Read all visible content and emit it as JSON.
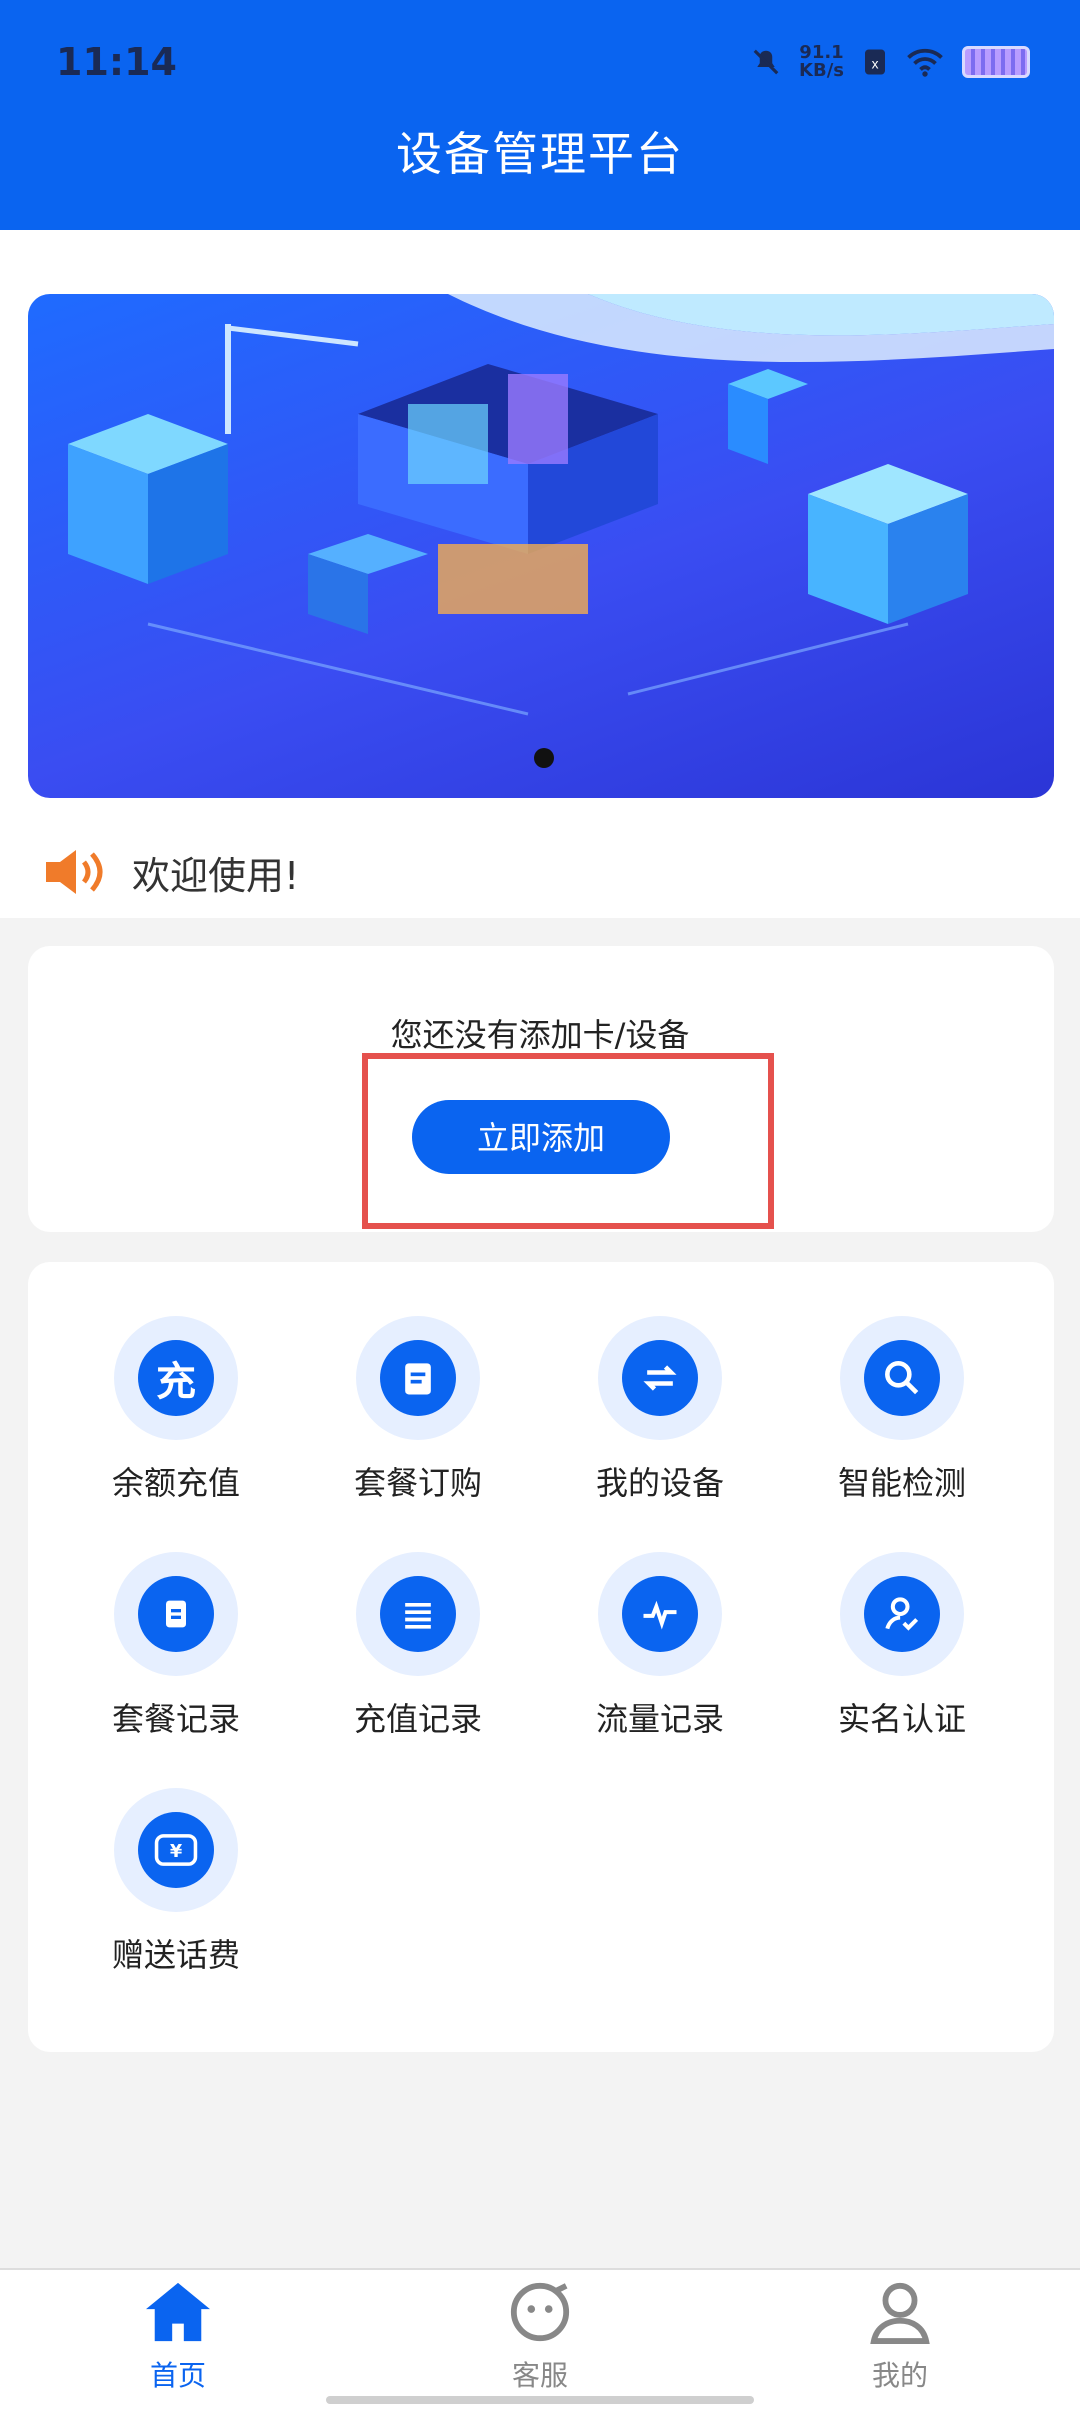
{
  "status_bar": {
    "time": "11:14",
    "net_speed": "91.1",
    "net_unit": "KB/s"
  },
  "header": {
    "title": "设备管理平台"
  },
  "banner": {
    "page_count": 1,
    "active_index": 0
  },
  "notice": {
    "text": "欢迎使用!"
  },
  "empty_state": {
    "message": "您还没有添加卡/设备",
    "button_label": "立即添加"
  },
  "grid": {
    "items": [
      {
        "label": "余额充值",
        "icon": "recharge-icon"
      },
      {
        "label": "套餐订购",
        "icon": "order-icon"
      },
      {
        "label": "我的设备",
        "icon": "device-icon"
      },
      {
        "label": "智能检测",
        "icon": "search-icon"
      },
      {
        "label": "套餐记录",
        "icon": "package-record-icon"
      },
      {
        "label": "充值记录",
        "icon": "list-icon"
      },
      {
        "label": "流量记录",
        "icon": "traffic-icon"
      },
      {
        "label": "实名认证",
        "icon": "verify-user-icon"
      },
      {
        "label": "赠送话费",
        "icon": "gift-fee-icon"
      }
    ]
  },
  "tabs": [
    {
      "label": "首页",
      "icon": "home-icon",
      "active": true
    },
    {
      "label": "客服",
      "icon": "service-icon",
      "active": false
    },
    {
      "label": "我的",
      "icon": "profile-icon",
      "active": false
    }
  ],
  "colors": {
    "primary": "#0a64f0",
    "highlight": "#e5514d",
    "speaker": "#f07b2a"
  }
}
